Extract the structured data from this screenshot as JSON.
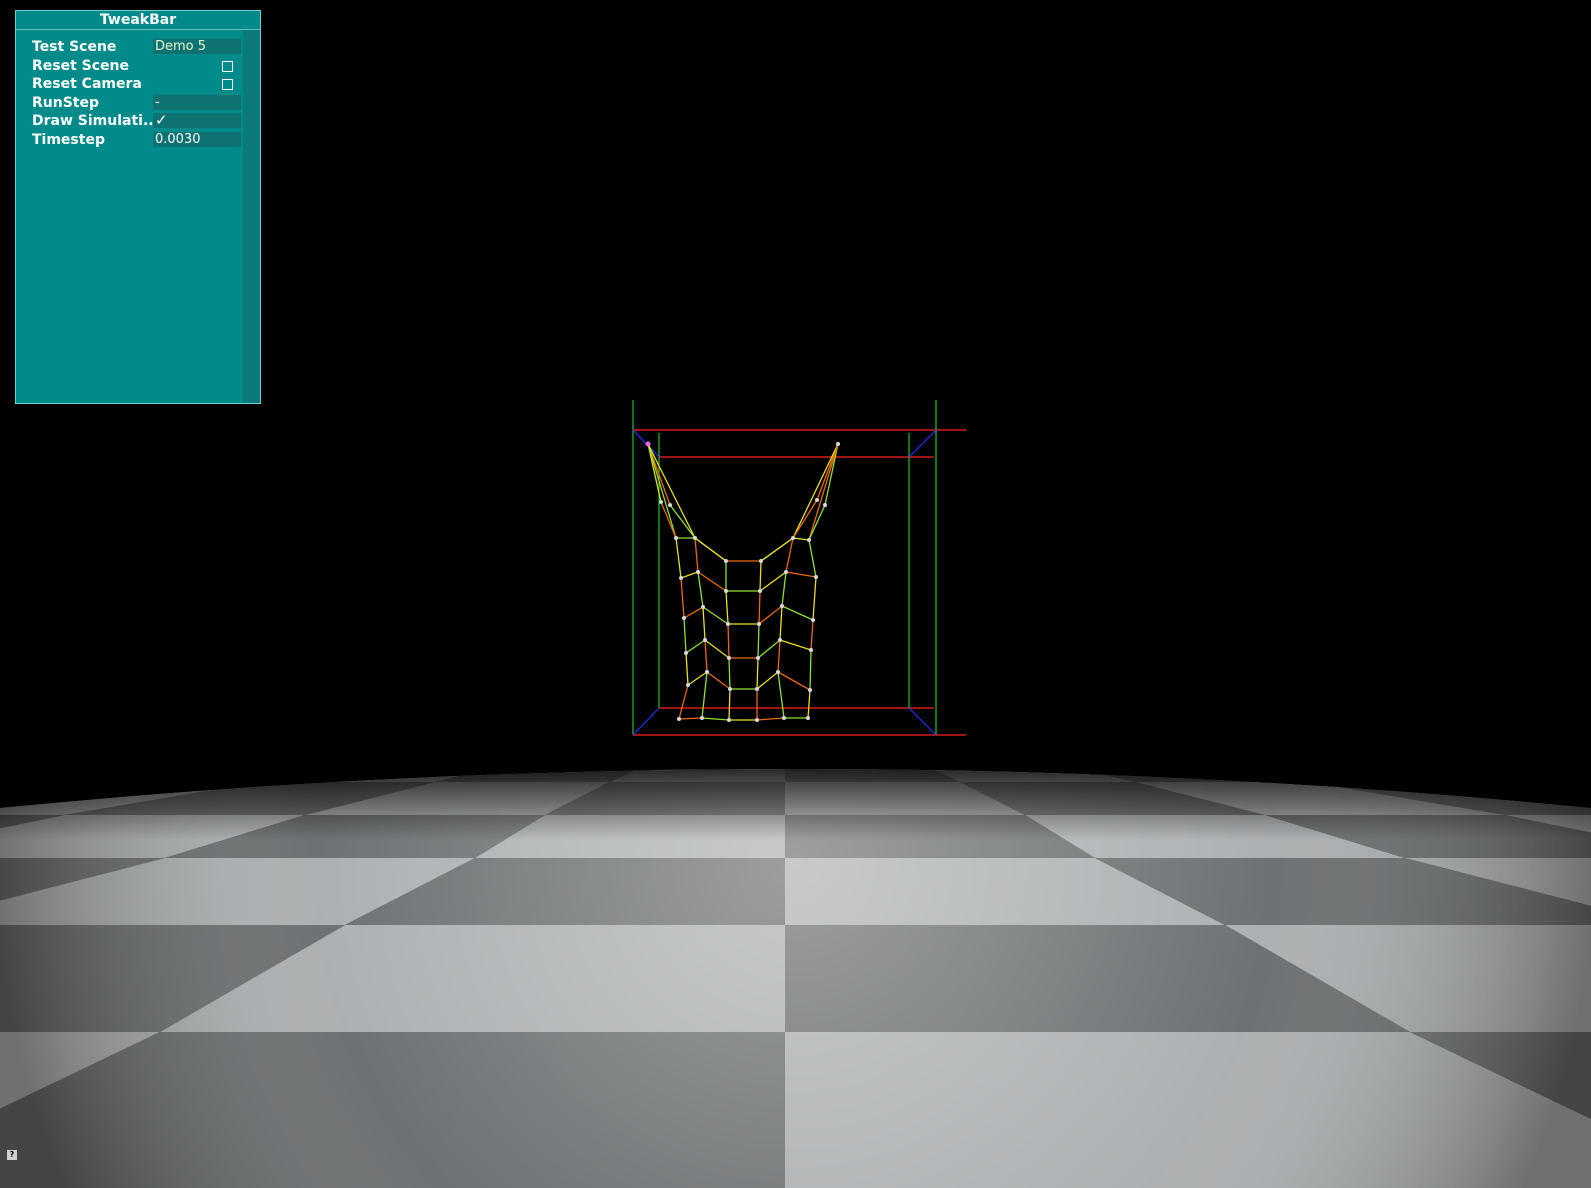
{
  "tweakbar": {
    "title": "TweakBar",
    "rows": [
      {
        "label": "Test Scene",
        "value": "Demo 5",
        "kind": "text"
      },
      {
        "label": "Reset Scene",
        "kind": "button"
      },
      {
        "label": "Reset Camera",
        "kind": "button"
      },
      {
        "label": "RunStep",
        "value": "-",
        "kind": "text"
      },
      {
        "label": "Draw Simulati..",
        "value": "✓",
        "kind": "check",
        "checked": true
      },
      {
        "label": "Timestep",
        "value": "0.0030",
        "kind": "text"
      }
    ]
  },
  "help_icon": "?",
  "colors": {
    "panel": "#008a8a",
    "box_red": "#ff2020",
    "box_green": "#20c020",
    "box_blue": "#2030ff",
    "mesh_yellow": "#e8e020",
    "mesh_orange": "#e86a10",
    "mesh_green": "#90e030"
  }
}
